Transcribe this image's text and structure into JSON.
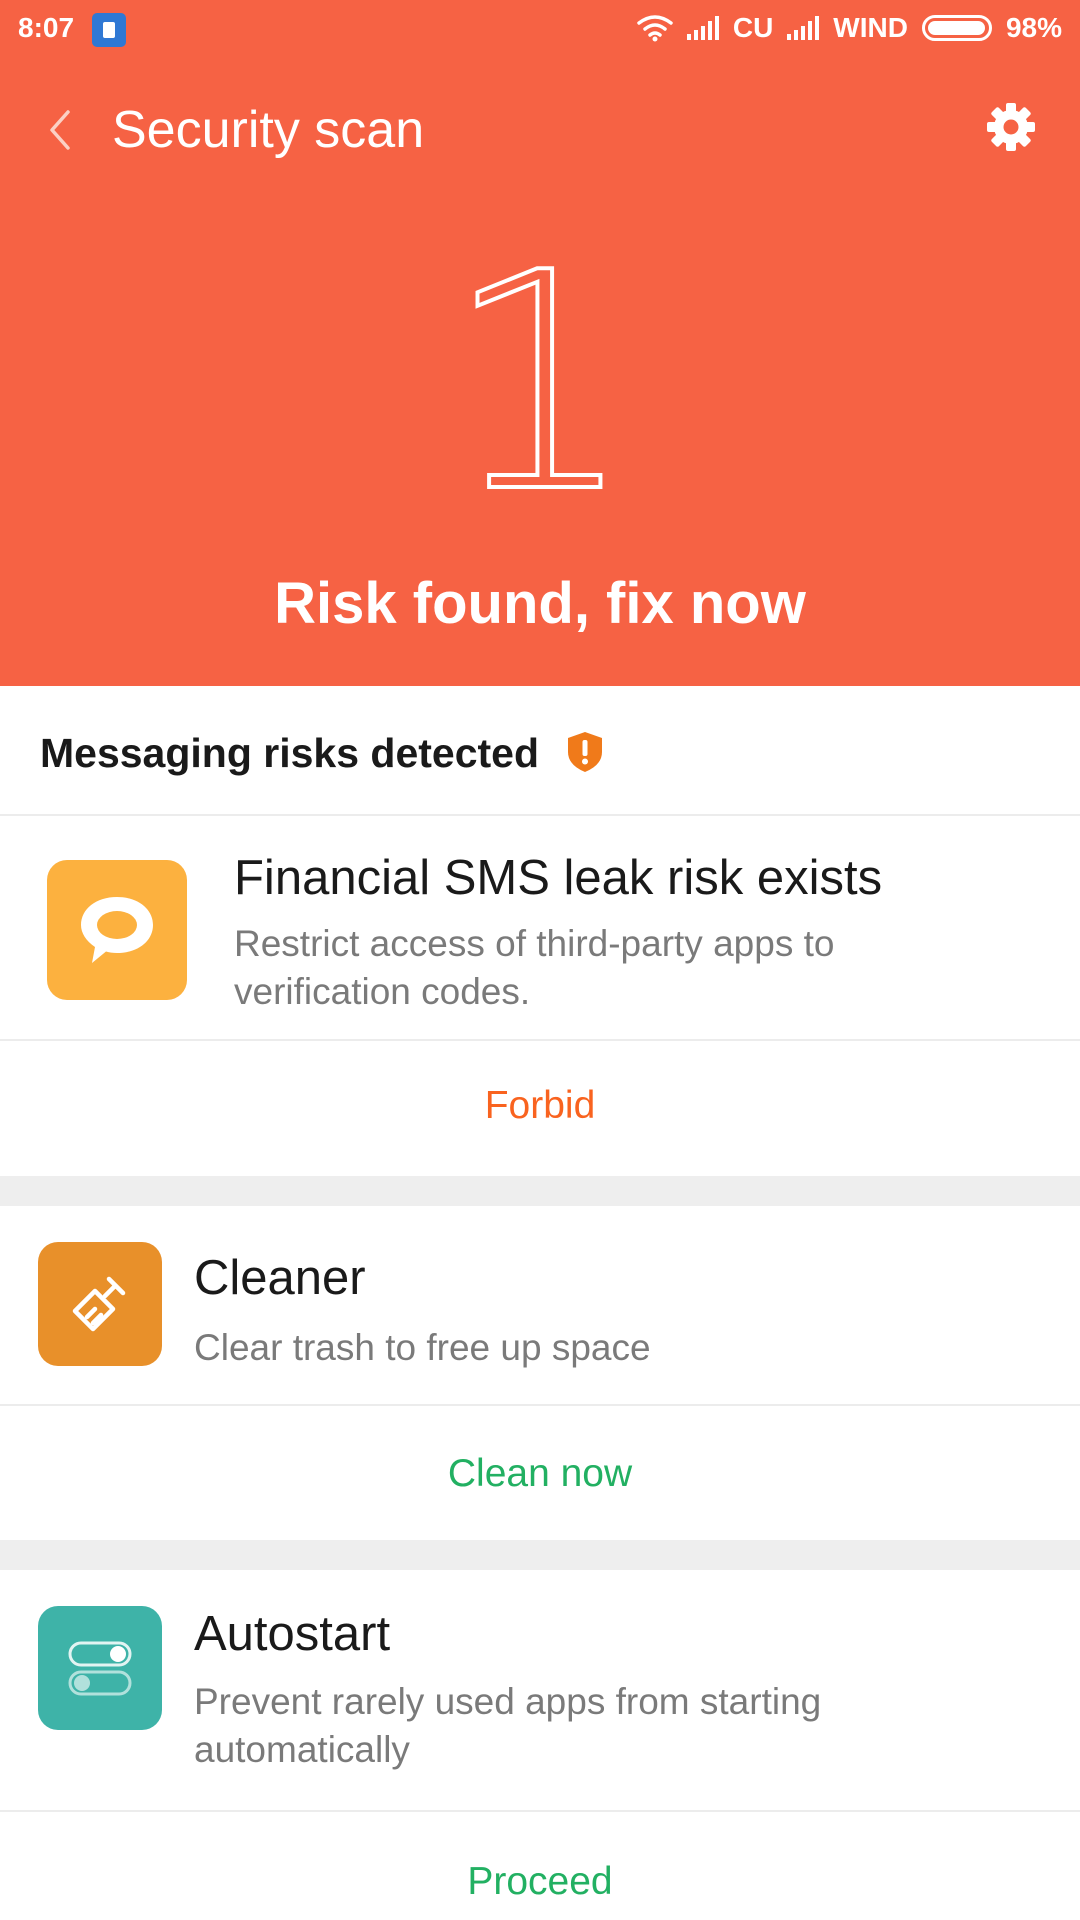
{
  "status_bar": {
    "time": "8:07",
    "carrier1": "CU",
    "carrier2": "WIND",
    "battery_level": "98%",
    "battery_fraction": 0.98
  },
  "app_bar": {
    "title": "Security scan",
    "back_icon": "chevron-left-icon",
    "settings_icon": "gear-icon"
  },
  "summary": {
    "risk_count": "1",
    "message": "Risk found, fix now",
    "color": "#f66244"
  },
  "section": {
    "title": "Messaging risks detected",
    "warning_icon": "shield-warning-icon",
    "warning_color": "#f07a1a"
  },
  "items": [
    {
      "title": "Financial SMS leak risk exists",
      "description": "Restrict access of third-party apps to verification codes.",
      "action": "Forbid",
      "action_color": "#f9631f",
      "icon": "message-bubble-icon",
      "icon_color": "#fcb13f"
    },
    {
      "title": "Cleaner",
      "description": "Clear trash to free up space",
      "action": "Clean now",
      "action_color": "#22b062",
      "icon": "broom-icon",
      "icon_color": "#e8902a"
    },
    {
      "title": "Autostart",
      "description": "Prevent rarely used apps from starting automatically",
      "action": "Proceed",
      "action_color": "#22b062",
      "icon": "toggle-switch-icon",
      "icon_color": "#3eb3a8"
    }
  ]
}
